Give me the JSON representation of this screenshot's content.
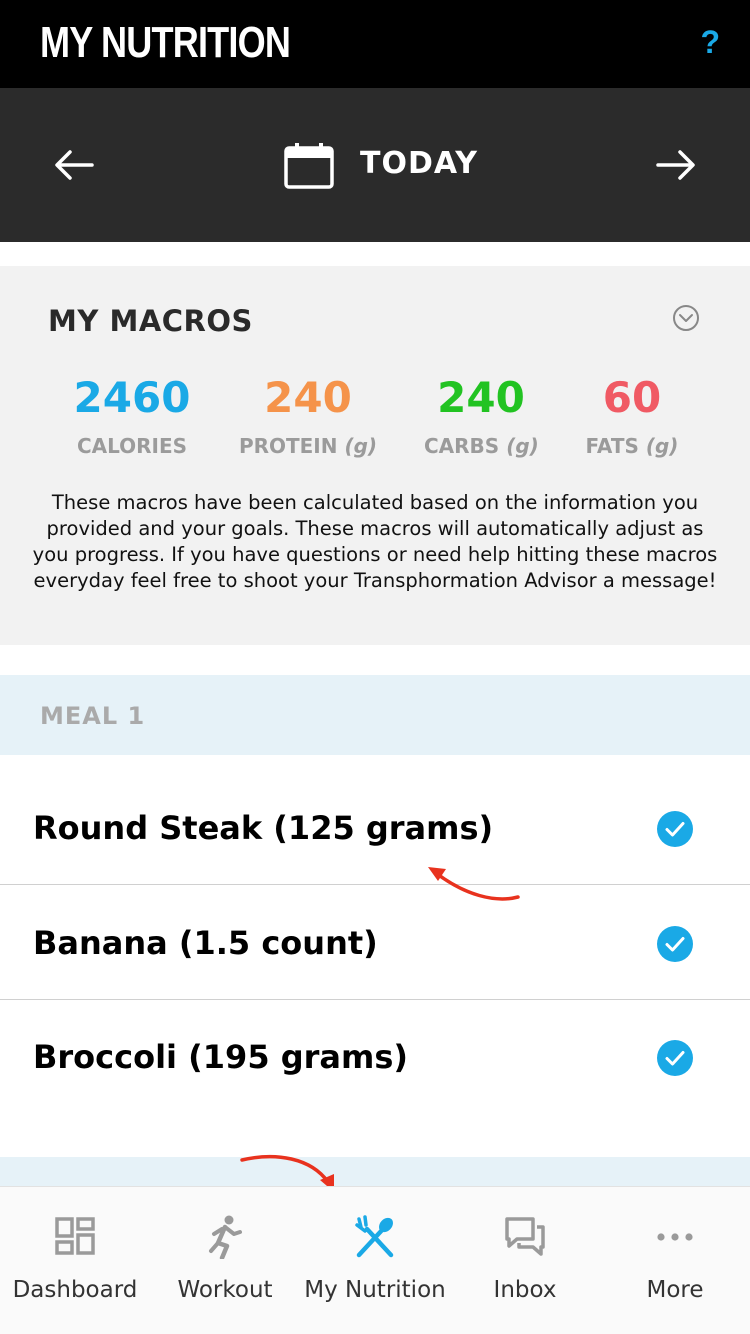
{
  "header": {
    "title": "MY NUTRITION",
    "help_label": "?"
  },
  "datebar": {
    "label": "TODAY"
  },
  "macros": {
    "title": "MY MACROS",
    "items": [
      {
        "value": "2460",
        "label": "CALORIES",
        "unit": "",
        "color": "#1aa9e6"
      },
      {
        "value": "240",
        "label": "PROTEIN",
        "unit": "(g)",
        "color": "#f5934a"
      },
      {
        "value": "240",
        "label": "CARBS",
        "unit": "(g)",
        "color": "#22c322"
      },
      {
        "value": "60",
        "label": "FATS",
        "unit": "(g)",
        "color": "#f05a64"
      }
    ],
    "description": "These macros have been calculated based on the information you provided and your goals. These macros will automatically adjust as you progress. If you have questions or need help hitting these macros everyday feel free to shoot your Transphormation Advisor a message!"
  },
  "meal": {
    "title": "MEAL 1",
    "foods": [
      {
        "name": "Round Steak (125 grams)",
        "checked": true
      },
      {
        "name": "Banana (1.5 count)",
        "checked": true
      },
      {
        "name": "Broccoli (195 grams)",
        "checked": true
      }
    ]
  },
  "tabs": [
    {
      "label": "Dashboard",
      "icon": "dashboard-icon",
      "active": false
    },
    {
      "label": "Workout",
      "icon": "runner-icon",
      "active": false
    },
    {
      "label": "My Nutrition",
      "icon": "utensils-icon",
      "active": true
    },
    {
      "label": "Inbox",
      "icon": "chat-icon",
      "active": false
    },
    {
      "label": "More",
      "icon": "more-icon",
      "active": false
    }
  ],
  "colors": {
    "accent": "#1aa9e6",
    "annotation": "#e8321e",
    "header_bg": "#000000",
    "datebar_bg": "#2b2b2b"
  }
}
